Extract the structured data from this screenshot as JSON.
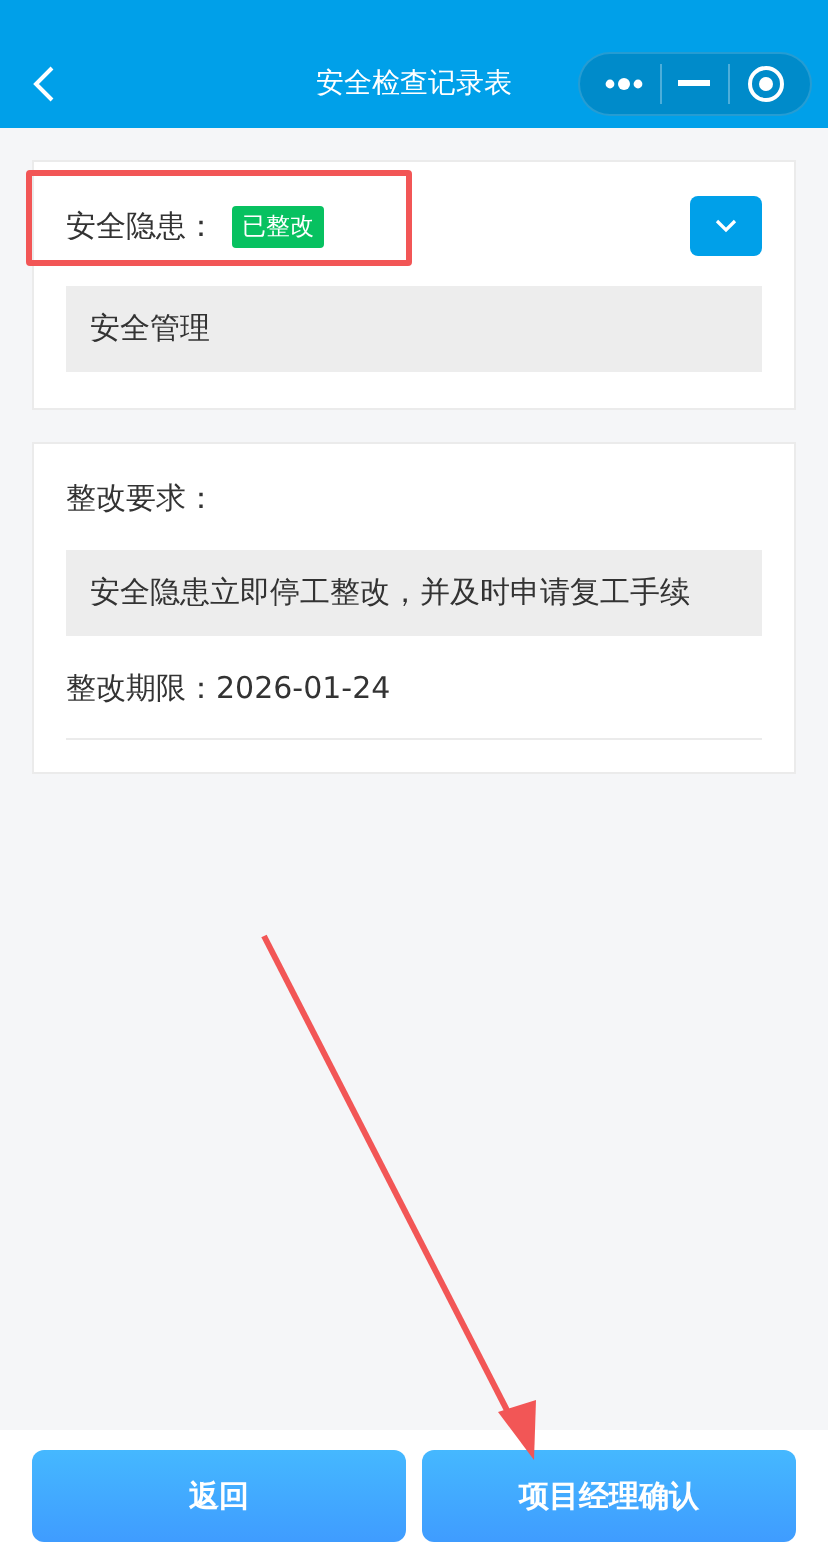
{
  "nav": {
    "title": "安全检查记录表"
  },
  "hazard": {
    "label": "安全隐患：",
    "status": "已整改",
    "expanded": false,
    "value": "安全管理"
  },
  "rectification": {
    "label": "整改要求：",
    "requirement": "安全隐患立即停工整改，并及时申请复工手续",
    "deadline": "整改期限：2026-01-24"
  },
  "buttons": [
    {
      "label": "返回"
    },
    {
      "label": "项目经理确认"
    }
  ]
}
